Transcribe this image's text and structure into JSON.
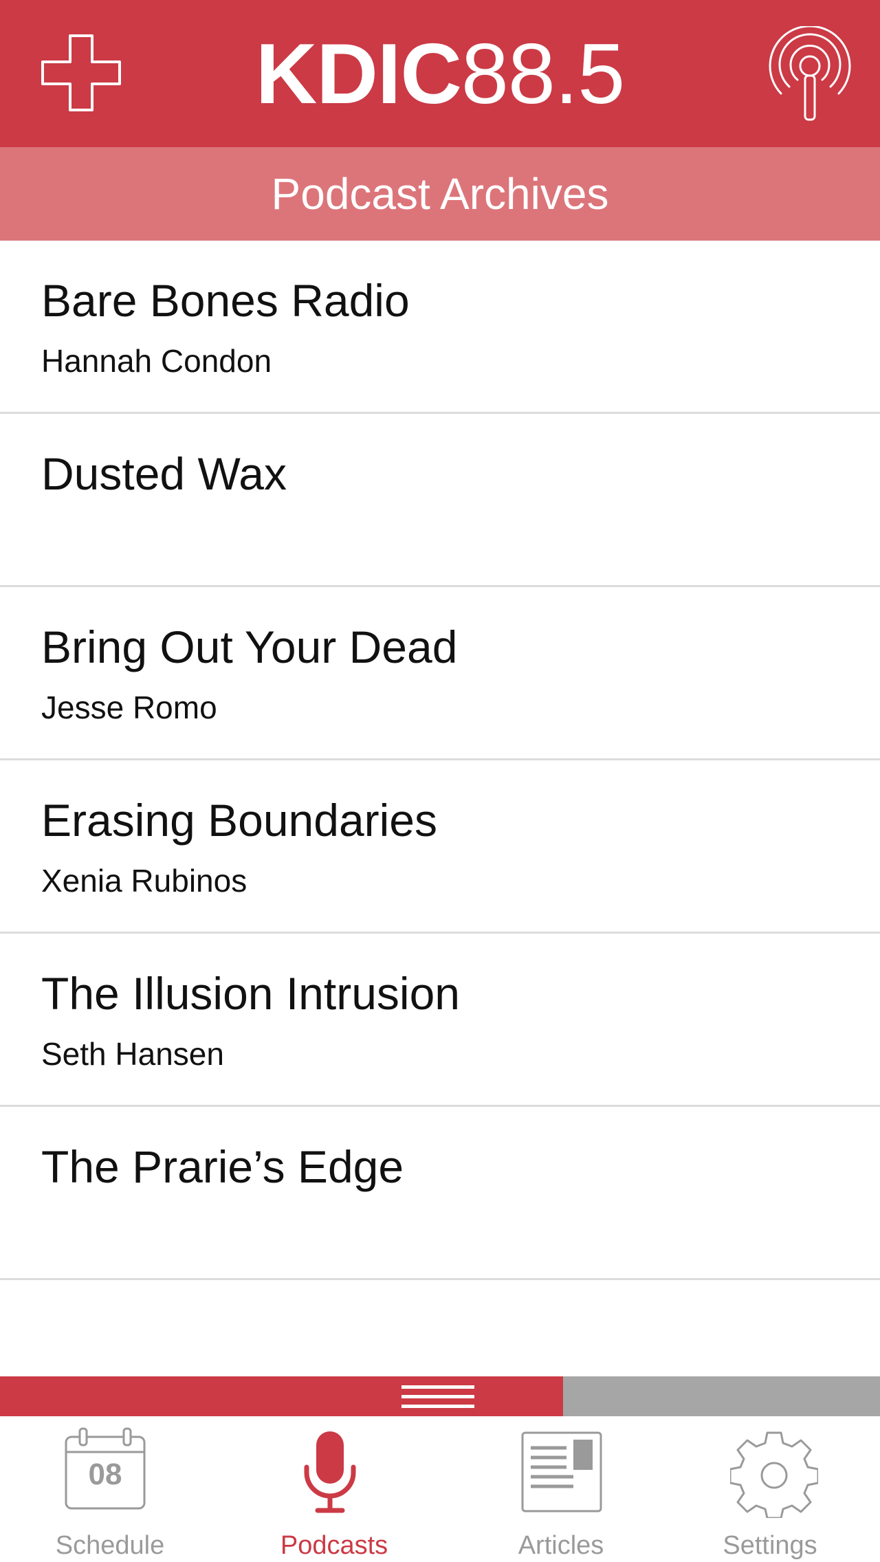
{
  "header": {
    "brand": "KDIC",
    "frequency": "88.5",
    "background_color": "#cb3a45"
  },
  "subheader": {
    "title": "Podcast Archives",
    "background_color": "#dc757a"
  },
  "podcasts": [
    {
      "title": "Bare Bones Radio",
      "host": "Hannah Condon"
    },
    {
      "title": "Dusted Wax",
      "host": ""
    },
    {
      "title": "Bring Out Your Dead",
      "host": "Jesse Romo"
    },
    {
      "title": "Erasing Boundaries",
      "host": "Xenia Rubinos"
    },
    {
      "title": "The Illusion Intrusion",
      "host": "Seth Hansen"
    },
    {
      "title": "The Prarie’s Edge",
      "host": ""
    }
  ],
  "player": {
    "progress_fraction": 0.64
  },
  "tabs": [
    {
      "label": "Schedule",
      "icon": "calendar-icon",
      "calendar_day": "08",
      "active": false
    },
    {
      "label": "Podcasts",
      "icon": "microphone-icon",
      "active": true
    },
    {
      "label": "Articles",
      "icon": "newspaper-icon",
      "active": false
    },
    {
      "label": "Settings",
      "icon": "gear-icon",
      "active": false
    }
  ],
  "colors": {
    "accent": "#cb3a45",
    "inactive": "#9a9a9a",
    "divider": "#dcdcdc"
  }
}
